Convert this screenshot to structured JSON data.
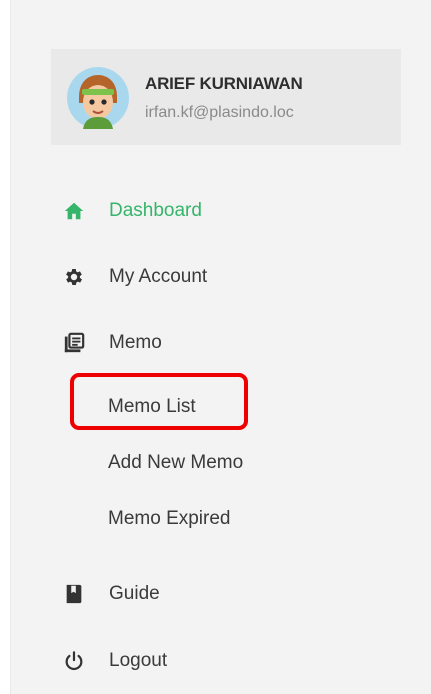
{
  "user": {
    "name": "ARIEF KURNIAWAN",
    "email": "irfan.kf@plasindo.loc"
  },
  "nav": {
    "dashboard": {
      "label": "Dashboard",
      "icon": "home-icon",
      "active": true
    },
    "account": {
      "label": "My Account",
      "icon": "gear-icon"
    },
    "memo": {
      "label": "Memo",
      "icon": "document-list-icon",
      "children": [
        {
          "label": "Memo List",
          "highlighted": true
        },
        {
          "label": "Add New Memo"
        },
        {
          "label": "Memo Expired"
        }
      ]
    },
    "guide": {
      "label": "Guide",
      "icon": "book-icon"
    },
    "logout": {
      "label": "Logout",
      "icon": "power-icon"
    }
  },
  "colors": {
    "active": "#35b56a",
    "highlight": "#ee0000",
    "text": "#3a3a3a"
  }
}
